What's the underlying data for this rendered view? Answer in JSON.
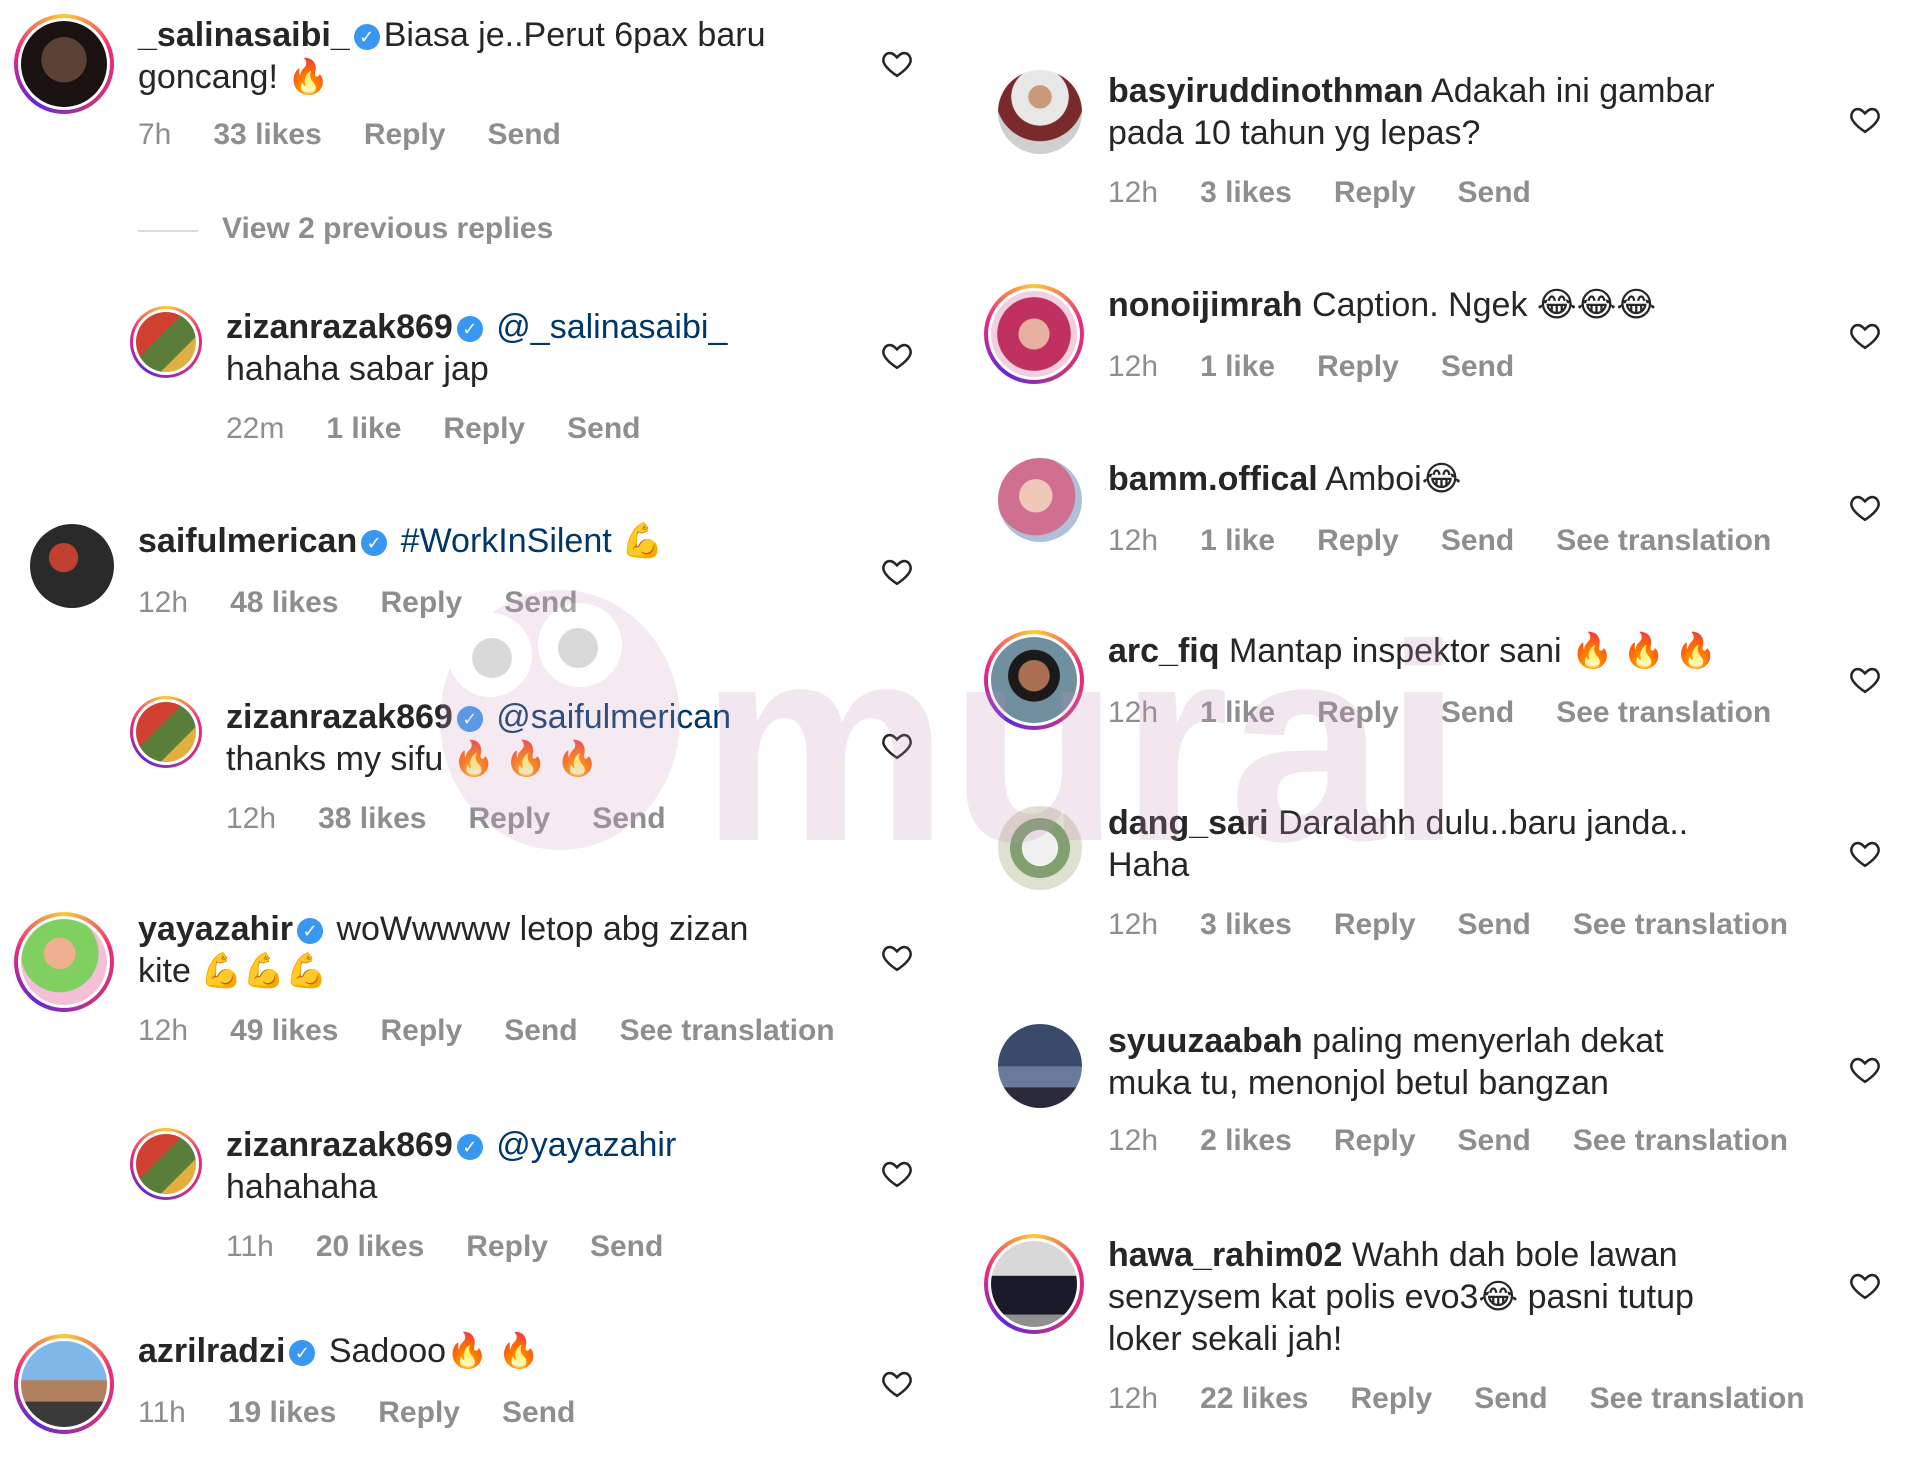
{
  "left": [
    {
      "user": "_salinasaibi_",
      "verified": true,
      "text": "Biasa je..Perut 6pax baru goncang! 🔥",
      "line1": "Biasa je..Perut 6pax baru",
      "line2": "goncang! 🔥",
      "time": "7h",
      "likes": "33 likes",
      "reply": "Reply",
      "send": "Send"
    },
    {
      "view_replies": "View 2 previous replies"
    },
    {
      "user": "zizanrazak869",
      "verified": true,
      "mention": "@_salinasaibi_",
      "line2": "hahaha sabar jap",
      "time": "22m",
      "likes": "1 like",
      "reply": "Reply",
      "send": "Send"
    },
    {
      "user": "saifulmerican",
      "verified": true,
      "hashtag": "#WorkInSilent",
      "emoji": "💪",
      "time": "12h",
      "likes": "48 likes",
      "reply": "Reply",
      "send": "Send"
    },
    {
      "user": "zizanrazak869",
      "verified": true,
      "mention": "@saifulmerican",
      "line2": "thanks my sifu 🔥 🔥 🔥",
      "time": "12h",
      "likes": "38 likes",
      "reply": "Reply",
      "send": "Send"
    },
    {
      "user": "yayazahir",
      "verified": true,
      "line1": "woWwwww letop abg zizan",
      "line2": "kite 💪💪💪",
      "time": "12h",
      "likes": "49 likes",
      "reply": "Reply",
      "send": "Send",
      "translation": "See translation"
    },
    {
      "user": "zizanrazak869",
      "verified": true,
      "mention": "@yayazahir",
      "line2": "hahahaha",
      "time": "11h",
      "likes": "20 likes",
      "reply": "Reply",
      "send": "Send"
    },
    {
      "user": "azrilradzi",
      "verified": true,
      "line1": "Sadooo🔥 🔥",
      "time": "11h",
      "likes": "19 likes",
      "reply": "Reply",
      "send": "Send"
    }
  ],
  "right": [
    {
      "user": "basyiruddinothman",
      "line1": "Adakah ini gambar",
      "line2": "pada 10 tahun yg lepas?",
      "time": "12h",
      "likes": "3 likes",
      "reply": "Reply",
      "send": "Send"
    },
    {
      "user": "nonoijimrah",
      "line1": "Caption. Ngek 😂😂😂",
      "time": "12h",
      "likes": "1 like",
      "reply": "Reply",
      "send": "Send"
    },
    {
      "user": "bamm.offical",
      "line1": "Amboi😂",
      "time": "12h",
      "likes": "1 like",
      "reply": "Reply",
      "send": "Send",
      "translation": "See translation"
    },
    {
      "user": "arc_fiq",
      "line1": "Mantap inspektor sani 🔥 🔥 🔥",
      "time": "12h",
      "likes": "1 like",
      "reply": "Reply",
      "send": "Send",
      "translation": "See translation"
    },
    {
      "user": "dang_sari",
      "line1": "Daralahh dulu..baru janda..",
      "line2": "Haha",
      "time": "12h",
      "likes": "3 likes",
      "reply": "Reply",
      "send": "Send",
      "translation": "See translation"
    },
    {
      "user": "syuuzaabah",
      "line1": "paling menyerlah dekat",
      "line2": "muka tu, menonjol betul bangzan",
      "time": "12h",
      "likes": "2 likes",
      "reply": "Reply",
      "send": "Send",
      "translation": "See translation"
    },
    {
      "user": "hawa_rahim02",
      "line1": "Wahh dah bole lawan",
      "line2": "senzysem kat polis evo3😂 pasni tutup",
      "line3": "loker sekali jah!",
      "time": "12h",
      "likes": "22 likes",
      "reply": "Reply",
      "send": "Send",
      "translation": "See translation"
    }
  ],
  "watermark": "murai",
  "colors": {
    "meta": "#8e8e8e",
    "text": "#262626",
    "mention": "#00376b",
    "verified": "#3897f0"
  }
}
